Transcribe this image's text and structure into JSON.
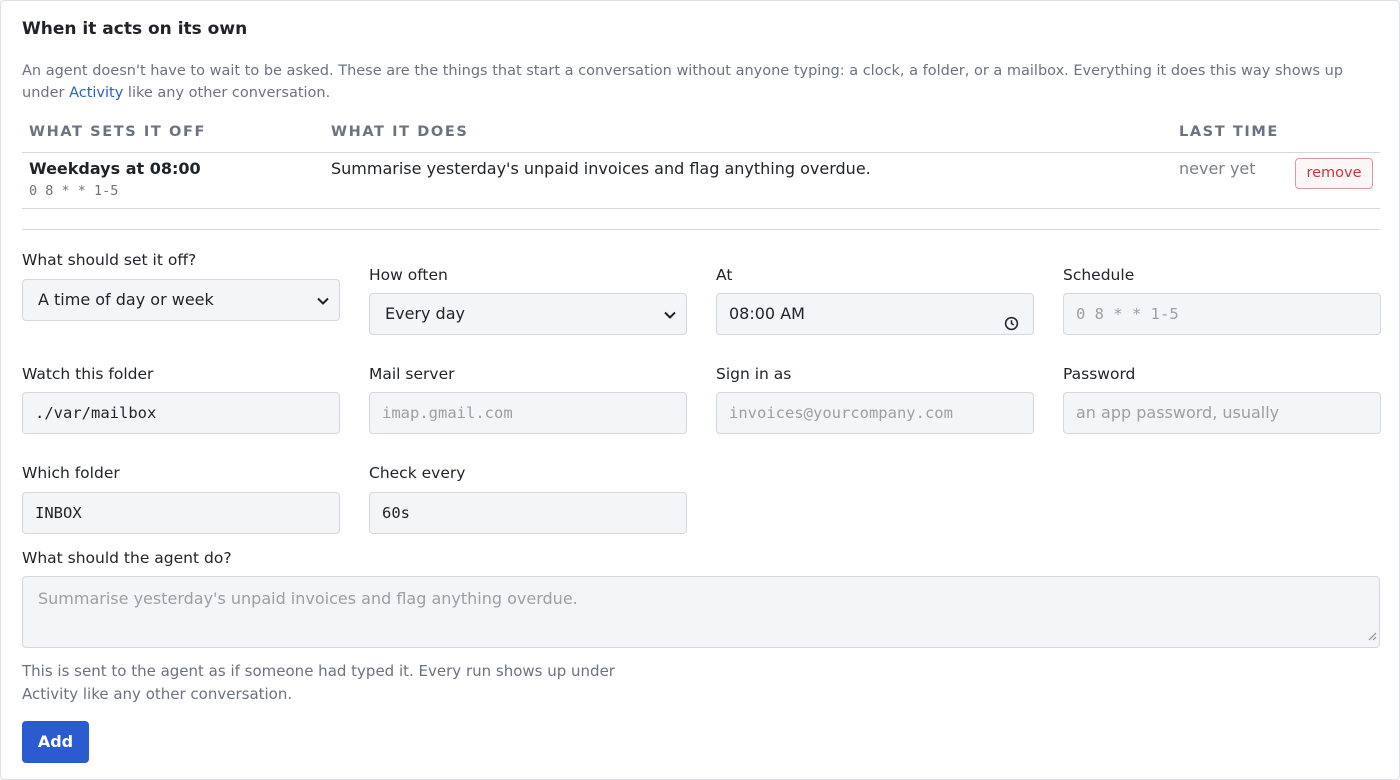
{
  "section": {
    "title": "When it acts on its own",
    "intro_before_link": "An agent doesn't have to wait to be asked. These are the things that start a conversation without anyone typing: a clock, a folder, or a mailbox. Everything it does this way shows up under ",
    "intro_link": "Activity",
    "intro_after_link": " like any other conversation."
  },
  "table": {
    "headers": [
      "WHAT SETS IT OFF",
      "WHAT IT DOES",
      "LAST TIME"
    ],
    "rows": [
      {
        "trigger": "Weekdays at 08:00",
        "cron": "0 8 * * 1-5",
        "does": "Summarise yesterday's unpaid invoices and flag anything overdue.",
        "last_time": "never yet",
        "action": "remove"
      }
    ]
  },
  "form": {
    "trigger_type": {
      "label": "What should set it off?",
      "value": "A time of day or week"
    },
    "how_often": {
      "label": "How often",
      "value": "Every day"
    },
    "at": {
      "label": "At",
      "value": "08:00 AM"
    },
    "schedule": {
      "label": "Schedule",
      "placeholder": "0 8 * * 1-5"
    },
    "watch_folder": {
      "label": "Watch this folder",
      "value": "./var/mailbox"
    },
    "mail_server": {
      "label": "Mail server",
      "placeholder": "imap.gmail.com"
    },
    "sign_in_as": {
      "label": "Sign in as",
      "placeholder": "invoices@yourcompany.com"
    },
    "password": {
      "label": "Password",
      "placeholder": "an app password, usually"
    },
    "which_folder": {
      "label": "Which folder",
      "value": "INBOX"
    },
    "check_every": {
      "label": "Check every",
      "value": "60s"
    },
    "agent_task": {
      "label": "What should the agent do?",
      "placeholder": "Summarise yesterday's unpaid invoices and flag anything overdue."
    },
    "help_text": "This is sent to the agent as if someone had typed it. Every run shows up under Activity like any other conversation.",
    "submit_label": "Add"
  },
  "colors": {
    "accent": "#2b5ccf",
    "link": "#2563c9",
    "danger": "#c23a3a"
  }
}
